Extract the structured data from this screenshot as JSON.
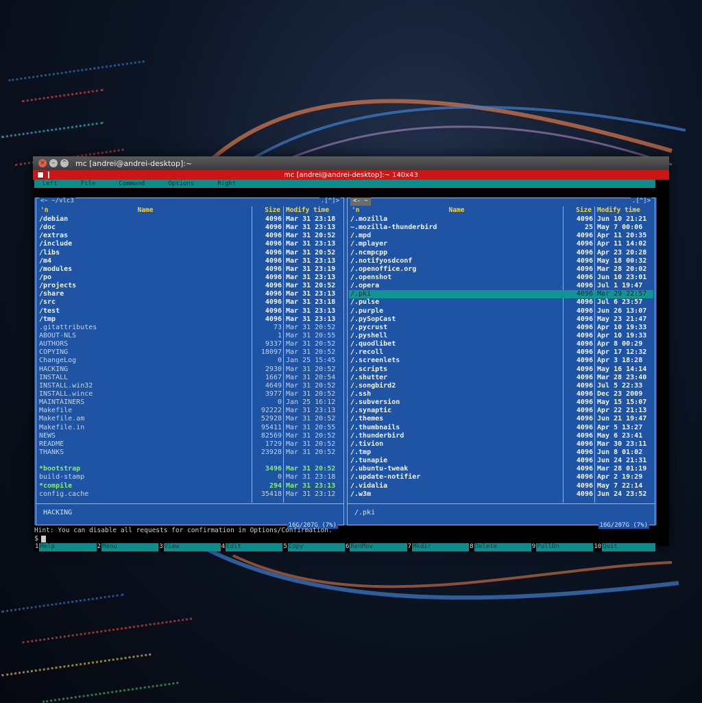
{
  "window": {
    "titlebar_title": "mc [andrei@andrei-desktop]:~",
    "terminal_title": "mc [andrei@andrei-desktop]:~ 140x43"
  },
  "menu": [
    "Left",
    "File",
    "Command",
    "Options",
    "Right"
  ],
  "left_panel": {
    "path": "<~ ~/vlc3",
    "corner": ".[^]>",
    "header": {
      "n": "'n",
      "name": "Name",
      "size": "Size",
      "modify": "Modify time"
    },
    "rows": [
      {
        "name": "/debian",
        "size": "4096",
        "modify": "Mar 31 23:18",
        "kind": "dir"
      },
      {
        "name": "/doc",
        "size": "4096",
        "modify": "Mar 31 23:13",
        "kind": "dir"
      },
      {
        "name": "/extras",
        "size": "4096",
        "modify": "Mar 31 20:52",
        "kind": "dir"
      },
      {
        "name": "/include",
        "size": "4096",
        "modify": "Mar 31 23:13",
        "kind": "dir"
      },
      {
        "name": "/libs",
        "size": "4096",
        "modify": "Mar 31 20:52",
        "kind": "dir"
      },
      {
        "name": "/m4",
        "size": "4096",
        "modify": "Mar 31 23:13",
        "kind": "dir"
      },
      {
        "name": "/modules",
        "size": "4096",
        "modify": "Mar 31 23:19",
        "kind": "dir"
      },
      {
        "name": "/po",
        "size": "4096",
        "modify": "Mar 31 23:13",
        "kind": "dir"
      },
      {
        "name": "/projects",
        "size": "4096",
        "modify": "Mar 31 20:52",
        "kind": "dir"
      },
      {
        "name": "/share",
        "size": "4096",
        "modify": "Mar 31 23:13",
        "kind": "dir"
      },
      {
        "name": "/src",
        "size": "4096",
        "modify": "Mar 31 23:18",
        "kind": "dir"
      },
      {
        "name": "/test",
        "size": "4096",
        "modify": "Mar 31 23:13",
        "kind": "dir"
      },
      {
        "name": "/tmp",
        "size": "4096",
        "modify": "Mar 31 23:13",
        "kind": "dir"
      },
      {
        "name": " .gitattributes",
        "size": "73",
        "modify": "Mar 31 20:52",
        "kind": "file"
      },
      {
        "name": " ABOUT-NLS",
        "size": "1",
        "modify": "Mar 31 20:55",
        "kind": "file"
      },
      {
        "name": " AUTHORS",
        "size": "9337",
        "modify": "Mar 31 20:52",
        "kind": "file"
      },
      {
        "name": " COPYING",
        "size": "18097",
        "modify": "Mar 31 20:52",
        "kind": "file"
      },
      {
        "name": " ChangeLog",
        "size": "0",
        "modify": "Jan 25 15:45",
        "kind": "file"
      },
      {
        "name": " HACKING",
        "size": "2930",
        "modify": "Mar 31 20:52",
        "kind": "file"
      },
      {
        "name": " INSTALL",
        "size": "1667",
        "modify": "Mar 31 20:54",
        "kind": "file"
      },
      {
        "name": " INSTALL.win32",
        "size": "4649",
        "modify": "Mar 31 20:52",
        "kind": "file"
      },
      {
        "name": " INSTALL.wince",
        "size": "3977",
        "modify": "Mar 31 20:52",
        "kind": "file"
      },
      {
        "name": " MAINTAINERS",
        "size": "0",
        "modify": "Jan 25 16:12",
        "kind": "file"
      },
      {
        "name": " Makefile",
        "size": "92222",
        "modify": "Mar 31 23:13",
        "kind": "file"
      },
      {
        "name": " Makefile.am",
        "size": "52928",
        "modify": "Mar 31 20:52",
        "kind": "file"
      },
      {
        "name": " Makefile.in",
        "size": "95411",
        "modify": "Mar 31 20:55",
        "kind": "file"
      },
      {
        "name": " NEWS",
        "size": "82569",
        "modify": "Mar 31 20:52",
        "kind": "file"
      },
      {
        "name": " README",
        "size": "1729",
        "modify": "Mar 31 20:52",
        "kind": "file"
      },
      {
        "name": " THANKS",
        "size": "23928",
        "modify": "Mar 31 20:52",
        "kind": "file"
      },
      {
        "name": "",
        "size": "",
        "modify": "",
        "kind": "hidden"
      },
      {
        "name": "*bootstrap",
        "size": "3496",
        "modify": "Mar 31 20:52",
        "kind": "exec"
      },
      {
        "name": " build-stamp",
        "size": "0",
        "modify": "Mar 31 23:18",
        "kind": "file"
      },
      {
        "name": "*compile",
        "size": "294",
        "modify": "Mar 31 23:13",
        "kind": "exec"
      },
      {
        "name": " config.cache",
        "size": "35418",
        "modify": "Mar 31 23:12",
        "kind": "file"
      }
    ],
    "mini_status": "HACKING",
    "disk": "16G/207G (7%)"
  },
  "right_panel": {
    "path": "<- ~",
    "corner": ".[^]>",
    "header": {
      "n": "'n",
      "name": "Name",
      "size": "Size",
      "modify": "Modify time"
    },
    "rows": [
      {
        "name": "/.mozilla",
        "size": "4096",
        "modify": "Jun 10 21:21",
        "kind": "dir"
      },
      {
        "name": "~.mozilla-thunderbird",
        "size": "25",
        "modify": "May  7 00:06",
        "kind": "dir"
      },
      {
        "name": "/.mpd",
        "size": "4096",
        "modify": "Apr 11 20:35",
        "kind": "dir"
      },
      {
        "name": "/.mplayer",
        "size": "4096",
        "modify": "Apr 11 14:02",
        "kind": "dir"
      },
      {
        "name": "/.ncmpcpp",
        "size": "4096",
        "modify": "Apr 23 20:28",
        "kind": "dir"
      },
      {
        "name": "/.notifyosdconf",
        "size": "4096",
        "modify": "May 18 00:32",
        "kind": "dir"
      },
      {
        "name": "/.openoffice.org",
        "size": "4096",
        "modify": "Mar 28 20:02",
        "kind": "dir"
      },
      {
        "name": "/.openshot",
        "size": "4096",
        "modify": "Jun 10 23:01",
        "kind": "dir"
      },
      {
        "name": "/.opera",
        "size": "4096",
        "modify": "Jul  1 19:47",
        "kind": "dir"
      },
      {
        "name": "/.pki",
        "size": "4096",
        "modify": "Mar 29 22:57",
        "kind": "sel"
      },
      {
        "name": "/.pulse",
        "size": "4096",
        "modify": "Jul  6 23:57",
        "kind": "dir"
      },
      {
        "name": "/.purple",
        "size": "4096",
        "modify": "Jun 26 13:07",
        "kind": "dir"
      },
      {
        "name": "/.pySopCast",
        "size": "4096",
        "modify": "May 23 21:47",
        "kind": "dir"
      },
      {
        "name": "/.pycrust",
        "size": "4096",
        "modify": "Apr 10 19:33",
        "kind": "dir"
      },
      {
        "name": "/.pyshell",
        "size": "4096",
        "modify": "Apr 10 19:33",
        "kind": "dir"
      },
      {
        "name": "/.quodlibet",
        "size": "4096",
        "modify": "Apr  8 00:29",
        "kind": "dir"
      },
      {
        "name": "/.recoll",
        "size": "4096",
        "modify": "Apr 17 12:32",
        "kind": "dir"
      },
      {
        "name": "/.screenlets",
        "size": "4096",
        "modify": "Apr  3 18:28",
        "kind": "dir"
      },
      {
        "name": "/.scripts",
        "size": "4096",
        "modify": "May 16 14:14",
        "kind": "dir"
      },
      {
        "name": "/.shutter",
        "size": "4096",
        "modify": "Mar 28 23:40",
        "kind": "dir"
      },
      {
        "name": "/.songbird2",
        "size": "4096",
        "modify": "Jul  5 22:33",
        "kind": "dir"
      },
      {
        "name": "/.ssh",
        "size": "4096",
        "modify": "Dec 23  2009",
        "kind": "dir"
      },
      {
        "name": "/.subversion",
        "size": "4096",
        "modify": "May 15 15:07",
        "kind": "dir"
      },
      {
        "name": "/.synaptic",
        "size": "4096",
        "modify": "Apr 22 21:13",
        "kind": "dir"
      },
      {
        "name": "/.themes",
        "size": "4096",
        "modify": "Jun 21 19:47",
        "kind": "dir"
      },
      {
        "name": "/.thumbnails",
        "size": "4096",
        "modify": "Apr  5 13:27",
        "kind": "dir"
      },
      {
        "name": "/.thunderbird",
        "size": "4096",
        "modify": "May  6 23:41",
        "kind": "dir"
      },
      {
        "name": "/.tivion",
        "size": "4096",
        "modify": "Mar 30 23:11",
        "kind": "dir"
      },
      {
        "name": "/.tmp",
        "size": "4096",
        "modify": "Jun  8 01:02",
        "kind": "dir"
      },
      {
        "name": "/.tunapie",
        "size": "4096",
        "modify": "Jun 24 21:31",
        "kind": "dir"
      },
      {
        "name": "/.ubuntu-tweak",
        "size": "4096",
        "modify": "Mar 28 01:19",
        "kind": "dir"
      },
      {
        "name": "/.update-notifier",
        "size": "4096",
        "modify": "Apr  2 19:29",
        "kind": "dir"
      },
      {
        "name": "/.vidalia",
        "size": "4096",
        "modify": "May  7 22:14",
        "kind": "dir"
      },
      {
        "name": "/.w3m",
        "size": "4096",
        "modify": "Jun 24 23:52",
        "kind": "dir"
      }
    ],
    "mini_status": "/.pki",
    "disk": "16G/207G (7%)"
  },
  "hint": "Hint: You can disable all requests for confirmation in Options/Confirmation.",
  "prompt": "$",
  "fkeys": [
    {
      "num": "1",
      "label": "Help"
    },
    {
      "num": "2",
      "label": "Menu"
    },
    {
      "num": "3",
      "label": "View"
    },
    {
      "num": "4",
      "label": "Edit"
    },
    {
      "num": "5",
      "label": "Copy"
    },
    {
      "num": "6",
      "label": "RenMov"
    },
    {
      "num": "7",
      "label": "Mkdir"
    },
    {
      "num": "8",
      "label": "Delete"
    },
    {
      "num": "9",
      "label": "PullDn"
    },
    {
      "num": "10",
      "label": "Quit"
    }
  ],
  "colors": {
    "panel_bg": "#1f53a3",
    "selection": "#129494",
    "title_red": "#cc1515",
    "header_yellow": "#f5d742",
    "exec_green": "#8af06a"
  }
}
